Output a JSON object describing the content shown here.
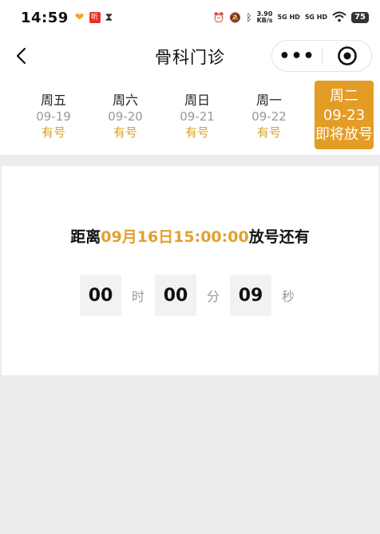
{
  "status_bar": {
    "time": "14:59",
    "badge_text": "听",
    "speed_value": "3.90",
    "speed_unit": "KB/s",
    "signal_1": "5G HD",
    "signal_2": "5G HD",
    "battery": "75"
  },
  "nav": {
    "title": "骨科门诊",
    "more_glyph": "•••"
  },
  "dates": [
    {
      "weekday": "周五",
      "date": "09-19",
      "status": "有号"
    },
    {
      "weekday": "周六",
      "date": "09-20",
      "status": "有号"
    },
    {
      "weekday": "周日",
      "date": "09-21",
      "status": "有号"
    },
    {
      "weekday": "周一",
      "date": "09-22",
      "status": "有号"
    },
    {
      "weekday": "周二",
      "date": "09-23",
      "status": "即将放号",
      "selected": true
    }
  ],
  "countdown": {
    "prefix": "距离",
    "release_time": "09月16日15:00:00",
    "suffix": "放号还有",
    "hours": "00",
    "hours_unit": "时",
    "minutes": "00",
    "minutes_unit": "分",
    "seconds": "09",
    "seconds_unit": "秒"
  },
  "colors": {
    "accent": "#e39c25",
    "status_text": "#d9a22a",
    "page_background": "#ededed"
  }
}
